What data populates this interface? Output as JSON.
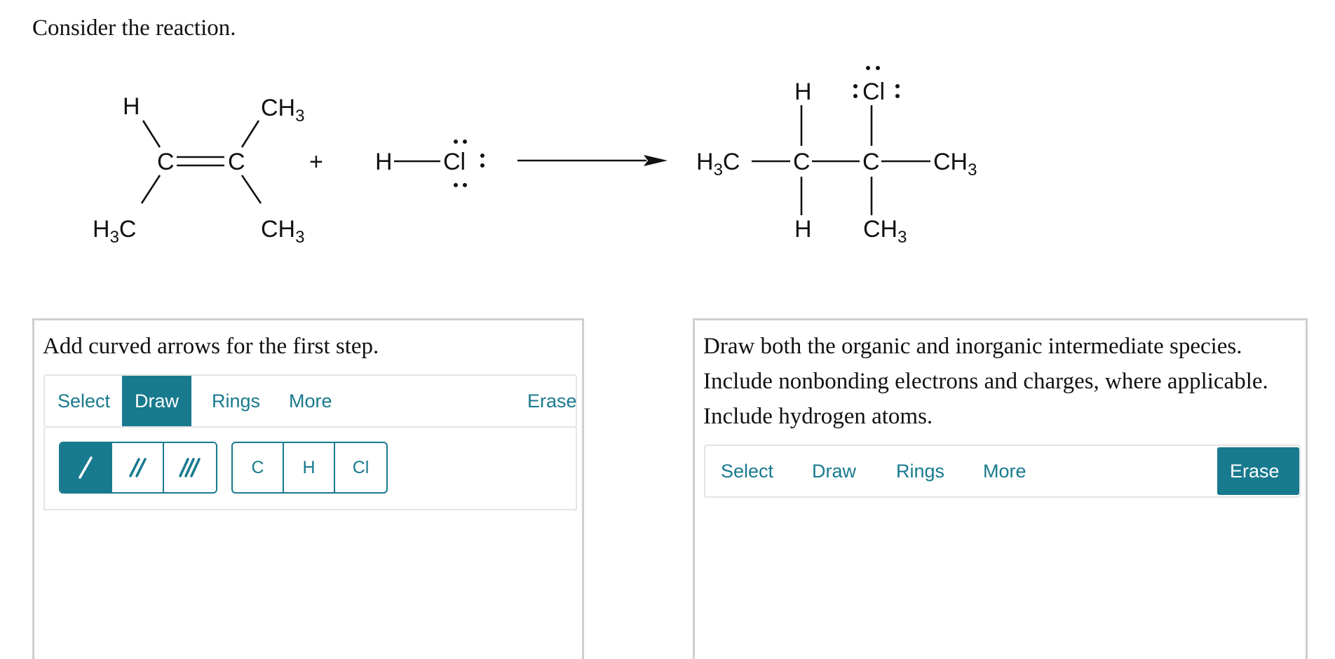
{
  "question": {
    "prompt": "Consider the reaction."
  },
  "reaction": {
    "plus": "+",
    "reactant1": {
      "top_left": "H",
      "top_right": "CH",
      "top_right_sub": "3",
      "left_c": "C",
      "right_c": "C",
      "bottom_left": "H",
      "bottom_left_sub": "3",
      "bottom_left_c": "C",
      "bottom_right": "CH",
      "bottom_right_sub": "3"
    },
    "reactant2": {
      "h": "H",
      "cl": "Cl"
    },
    "product": {
      "h3c": "H",
      "h3c_sub": "3",
      "h3c_c": "C",
      "c1": "C",
      "c2": "C",
      "ch3_right": "CH",
      "ch3_right_sub": "3",
      "h_top": "H",
      "cl_top": "Cl",
      "h_bottom": "H",
      "ch3_bottom": "CH",
      "ch3_bottom_sub": "3"
    }
  },
  "left_panel": {
    "title": "Add curved arrows for the first step.",
    "tabs": {
      "select": "Select",
      "draw": "Draw",
      "rings": "Rings",
      "more": "More",
      "erase": "Erase"
    },
    "atoms": [
      "C",
      "H",
      "Cl"
    ]
  },
  "right_panel": {
    "title": "Draw both the organic and inorganic intermediate species. Include nonbonding electrons and charges, where applicable. Include hydrogen atoms.",
    "tabs": {
      "select": "Select",
      "draw": "Draw",
      "rings": "Rings",
      "more": "More",
      "erase": "Erase"
    }
  },
  "colors": {
    "accent": "#187a8e",
    "panel_border": "#cfcfcf"
  }
}
